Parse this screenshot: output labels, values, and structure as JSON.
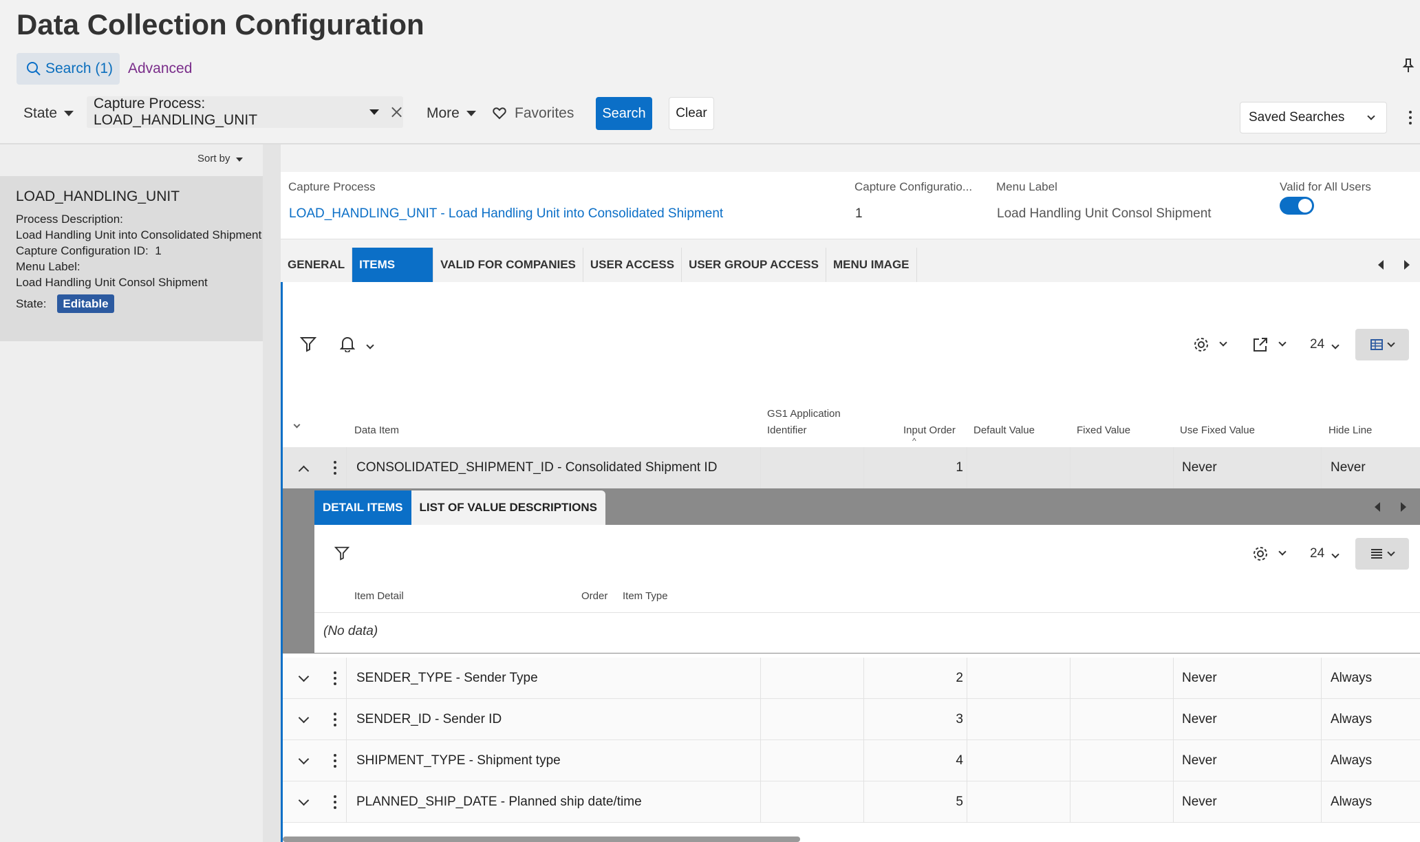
{
  "page_title": "Data Collection Configuration",
  "search_tab": "Search (1)",
  "advanced": "Advanced",
  "filters": {
    "state": "State",
    "capture_chip": "Capture Process: LOAD_HANDLING_UNIT",
    "more": "More",
    "favorites": "Favorites",
    "search_btn": "Search",
    "clear_btn": "Clear",
    "saved_searches": "Saved Searches"
  },
  "left": {
    "sort_by": "Sort by",
    "card_name": "LOAD_HANDLING_UNIT",
    "proc_desc_label": "Process Description:",
    "proc_desc": "Load Handling Unit into Consolidated Shipment",
    "cfg_id_label": "Capture Configuration ID:",
    "cfg_id": "1",
    "menu_label_label": "Menu Label:",
    "menu_label": "Load Handling Unit Consol Shipment",
    "state_label": "State:",
    "state": "Editable"
  },
  "header": {
    "capture_process_label": "Capture Process",
    "capture_process": "LOAD_HANDLING_UNIT - Load Handling Unit into Consolidated Shipment",
    "cfg_label": "Capture Configuratio...",
    "cfg_value": "1",
    "menu_label_label": "Menu Label",
    "menu_label": "Load Handling Unit Consol Shipment",
    "valid_label": "Valid for All Users",
    "valid_on": true
  },
  "tabs": [
    "GENERAL",
    "ITEMS",
    "VALID FOR COMPANIES",
    "USER ACCESS",
    "USER GROUP ACCESS",
    "MENU IMAGE"
  ],
  "toolbar": {
    "page_size": "24"
  },
  "columns": {
    "data_item": "Data Item",
    "gs1_1": "GS1 Application",
    "gs1_2": "Identifier",
    "input_order": "Input Order",
    "default_value": "Default Value",
    "fixed_value": "Fixed Value",
    "use_fixed": "Use Fixed Value",
    "hide_line": "Hide Line"
  },
  "rows": [
    {
      "item": "CONSOLIDATED_SHIPMENT_ID - Consolidated Shipment ID",
      "order": "1",
      "use_fixed": "Never",
      "hide": "Never"
    },
    {
      "item": "SENDER_TYPE - Sender Type",
      "order": "2",
      "use_fixed": "Never",
      "hide": "Always"
    },
    {
      "item": "SENDER_ID - Sender ID",
      "order": "3",
      "use_fixed": "Never",
      "hide": "Always"
    },
    {
      "item": "SHIPMENT_TYPE - Shipment type",
      "order": "4",
      "use_fixed": "Never",
      "hide": "Always"
    },
    {
      "item": "PLANNED_SHIP_DATE - Planned ship date/time",
      "order": "5",
      "use_fixed": "Never",
      "hide": "Always"
    }
  ],
  "detail": {
    "tab1": "DETAIL ITEMS",
    "tab2": "LIST OF VALUE DESCRIPTIONS",
    "page_size": "24",
    "col_item_detail": "Item Detail",
    "col_order": "Order",
    "col_item_type": "Item Type",
    "no_data": "(No data)"
  },
  "colors": {
    "accent": "#0b6fc7",
    "badge": "#2c5aa0",
    "advanced": "#7a2d8a"
  }
}
